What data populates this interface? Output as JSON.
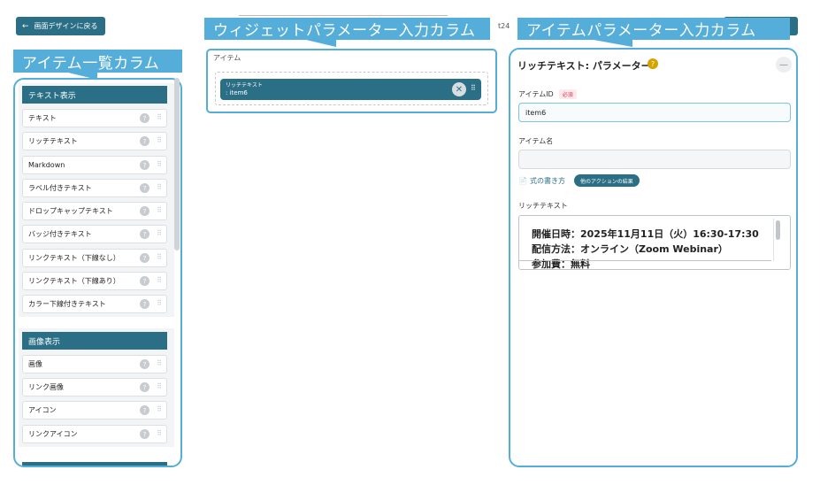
{
  "back_button": {
    "label": "画面デザインに戻る",
    "icon": "arrow-left-icon"
  },
  "callouts": {
    "left": "アイテム一覧カラム",
    "middle": "ウィジェットパラメーター入力カラム",
    "right": "アイテムパラメーター入力カラム"
  },
  "background_hint": {
    "partial_text": "t24"
  },
  "left_column": {
    "categories": [
      {
        "title": "テキスト表示",
        "items": [
          {
            "label": "テキスト"
          },
          {
            "label": "リッチテキスト"
          },
          {
            "label": "Markdown"
          },
          {
            "label": "ラベル付きテキスト"
          },
          {
            "label": "ドロップキャップテキスト"
          },
          {
            "label": "バッジ付きテキスト"
          },
          {
            "label": "リンクテキスト（下線なし）"
          },
          {
            "label": "リンクテキスト（下線あり）"
          },
          {
            "label": "カラー下線付きテキスト"
          }
        ]
      },
      {
        "title": "画像表示",
        "items": [
          {
            "label": "画像"
          },
          {
            "label": "リンク画像"
          },
          {
            "label": "アイコン"
          },
          {
            "label": "リンクアイコン"
          }
        ]
      }
    ]
  },
  "middle_column": {
    "section_label": "アイテム",
    "widget": {
      "type_label": "リッチテキスト",
      "item_id": ": item6",
      "remove_icon": "close-icon",
      "drag_icon": "drag-handle-icon"
    }
  },
  "right_column": {
    "title": "リッチテキスト: パラメーター",
    "item_id_label": "アイテムID",
    "required_badge": "必須",
    "item_id_value": "item6",
    "item_name_label": "アイテム名",
    "item_name_value": "",
    "formula_link": "式の書き方",
    "action_button": "他のアクションの結果",
    "rich_text_label": "リッチテキスト",
    "rich_text_lines": [
      "開催日時：2025年11月11日（火）16:30-17:30",
      "配信方法：オンライン（Zoom Webinar）",
      "参加費：無料"
    ]
  },
  "colors": {
    "primary": "#2a6f86",
    "callout": "#54aed9",
    "outline": "#54aed9",
    "required": "#d23a5a",
    "help": "#d4a300"
  }
}
